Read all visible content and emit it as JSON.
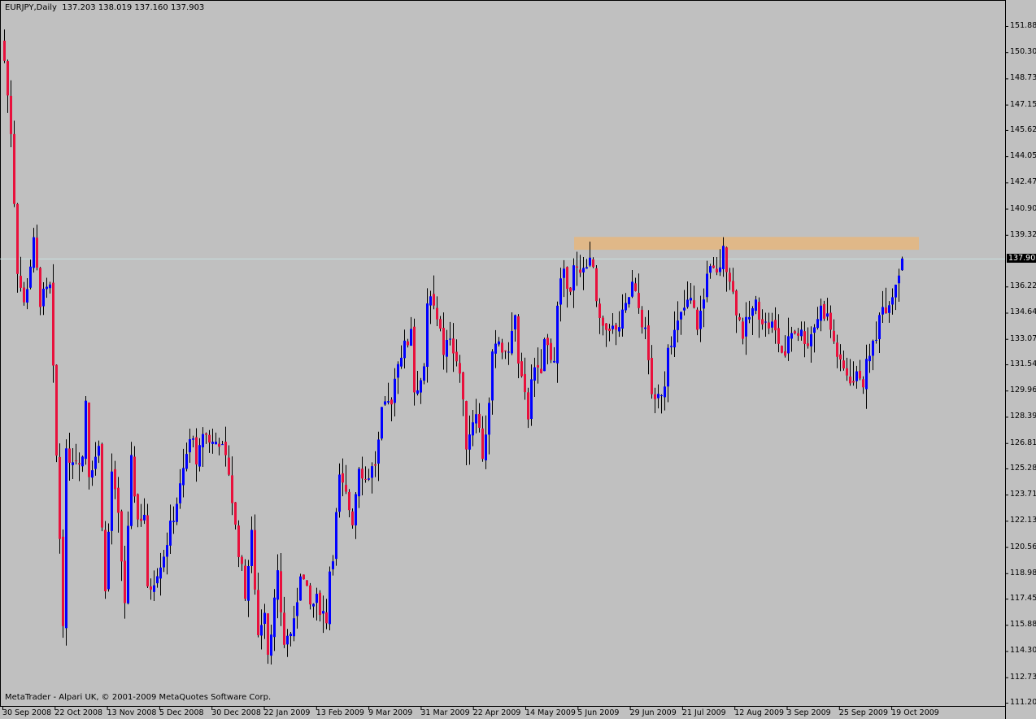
{
  "header": {
    "symbol": "EURJPY,Daily",
    "open": "137.203",
    "high": "138.019",
    "low": "137.160",
    "close": "137.903"
  },
  "footer": "MetaTrader - Alpari UK, © 2001-2009 MetaQuotes Software Corp.",
  "colors": {
    "background": "#c0c0c0",
    "bull": "#0000ff",
    "bear": "#e8103c",
    "wick": "#000000",
    "zone": "#e0b888",
    "price_line": "#c8e0e0"
  },
  "chart_data": {
    "type": "candlestick",
    "title": "EURJPY,Daily",
    "ylim": [
      111.2,
      151.88
    ],
    "y_ticks": [
      "151.880",
      "150.305",
      "148.730",
      "147.155",
      "145.625",
      "144.050",
      "142.475",
      "140.900",
      "139.325",
      "136.220",
      "134.645",
      "133.070",
      "131.540",
      "129.965",
      "128.390",
      "126.810",
      "125.285",
      "123.710",
      "122.135",
      "120.560",
      "118.985",
      "117.455",
      "115.880",
      "114.305",
      "112.730",
      "111.200"
    ],
    "current_price": "137.903",
    "x_ticks": [
      "30 Sep 2008",
      "22 Oct 2008",
      "13 Nov 2008",
      "5 Dec 2008",
      "30 Dec 2008",
      "22 Jan 2009",
      "13 Feb 2009",
      "9 Mar 2009",
      "31 Mar 2009",
      "22 Apr 2009",
      "14 May 2009",
      "5 Jun 2009",
      "29 Jun 2009",
      "21 Jul 2009",
      "12 Aug 2009",
      "3 Sep 2009",
      "25 Sep 2009",
      "19 Oct 2009"
    ],
    "resistance_zone": {
      "from_bar": 175,
      "to_bar": 281,
      "low": 138.43,
      "high": 139.2
    },
    "close_waypoints": [
      [
        0,
        149.8
      ],
      [
        2,
        145.6
      ],
      [
        4,
        137.3
      ],
      [
        6,
        135.1
      ],
      [
        9,
        138.8
      ],
      [
        11,
        135.4
      ],
      [
        14,
        136.1
      ],
      [
        15,
        131
      ],
      [
        16,
        126
      ],
      [
        18,
        116.3
      ],
      [
        19,
        126
      ],
      [
        21,
        126
      ],
      [
        24,
        126
      ],
      [
        25,
        129.5
      ],
      [
        26,
        125.1
      ],
      [
        29,
        126.5
      ],
      [
        31,
        117.8
      ],
      [
        33,
        125.1
      ],
      [
        35,
        122.2
      ],
      [
        37,
        117.3
      ],
      [
        39,
        125.6
      ],
      [
        41,
        122.2
      ],
      [
        43,
        122.6
      ],
      [
        44,
        117.8
      ],
      [
        46,
        118.7
      ],
      [
        49,
        120.2
      ],
      [
        51,
        121.7
      ],
      [
        54,
        124.1
      ],
      [
        56,
        126.1
      ],
      [
        58,
        127.5
      ],
      [
        59,
        125.1
      ],
      [
        61,
        127.5
      ],
      [
        64,
        126.8
      ],
      [
        66,
        127
      ],
      [
        69,
        125.1
      ],
      [
        71,
        121.7
      ],
      [
        74,
        117.8
      ],
      [
        76,
        121.2
      ],
      [
        78,
        115.3
      ],
      [
        80,
        117
      ],
      [
        81,
        114.3
      ],
      [
        84,
        118.7
      ],
      [
        86,
        114.8
      ],
      [
        89,
        115.8
      ],
      [
        91,
        119.2
      ],
      [
        94,
        117
      ],
      [
        96,
        117.3
      ],
      [
        99,
        116.3
      ],
      [
        100,
        119.2
      ],
      [
        101,
        120.2
      ],
      [
        103,
        124.6
      ],
      [
        105,
        123.6
      ],
      [
        107,
        122.2
      ],
      [
        109,
        125.6
      ],
      [
        111,
        124.6
      ],
      [
        114,
        125.6
      ],
      [
        115,
        126.8
      ],
      [
        116,
        128.5
      ],
      [
        119,
        129.5
      ],
      [
        121,
        131.9
      ],
      [
        124,
        132.9
      ],
      [
        125,
        133.9
      ],
      [
        126,
        130
      ],
      [
        129,
        131
      ],
      [
        130,
        134.9
      ],
      [
        131,
        135.4
      ],
      [
        134,
        133.9
      ],
      [
        135,
        131.9
      ],
      [
        137,
        133.4
      ],
      [
        140,
        131
      ],
      [
        141,
        129
      ],
      [
        142,
        126.8
      ],
      [
        145,
        129
      ],
      [
        147,
        126.1
      ],
      [
        149,
        129
      ],
      [
        150,
        131.9
      ],
      [
        152,
        132.9
      ],
      [
        154,
        131.9
      ],
      [
        156,
        133.4
      ],
      [
        157,
        134.4
      ],
      [
        158,
        131.4
      ],
      [
        160,
        129.5
      ],
      [
        161,
        128.5
      ],
      [
        162,
        131
      ],
      [
        165,
        131
      ],
      [
        166,
        132.9
      ],
      [
        169,
        131.9
      ],
      [
        170,
        134.9
      ],
      [
        171,
        136.3
      ],
      [
        172,
        136.8
      ],
      [
        174,
        136.3
      ],
      [
        175,
        137.3
      ],
      [
        177,
        136.8
      ],
      [
        179,
        137.8
      ],
      [
        181,
        137.3
      ],
      [
        182,
        134.9
      ],
      [
        184,
        133.4
      ],
      [
        186,
        133.9
      ],
      [
        188,
        133.4
      ],
      [
        189,
        133.9
      ],
      [
        191,
        134.9
      ],
      [
        193,
        136.3
      ],
      [
        195,
        134.9
      ],
      [
        197,
        133.4
      ],
      [
        199,
        130
      ],
      [
        200,
        129
      ],
      [
        203,
        130.5
      ],
      [
        204,
        132.9
      ],
      [
        206,
        133.4
      ],
      [
        209,
        134.9
      ],
      [
        211,
        135.4
      ],
      [
        213,
        133.9
      ],
      [
        215,
        135.4
      ],
      [
        216,
        137.3
      ],
      [
        219,
        136.8
      ],
      [
        221,
        138.3
      ],
      [
        223,
        136.8
      ],
      [
        224,
        135.8
      ],
      [
        225,
        134.9
      ],
      [
        227,
        133.4
      ],
      [
        229,
        134.4
      ],
      [
        231,
        135.1
      ],
      [
        234,
        133.9
      ],
      [
        236,
        133.9
      ],
      [
        238,
        132.9
      ],
      [
        240,
        131.7
      ],
      [
        241,
        133.4
      ],
      [
        243,
        133.6
      ],
      [
        245,
        133.4
      ],
      [
        247,
        132.9
      ],
      [
        249,
        133.9
      ],
      [
        251,
        134.9
      ],
      [
        253,
        134.4
      ],
      [
        255,
        132.9
      ],
      [
        257,
        131.4
      ],
      [
        259,
        131
      ],
      [
        261,
        130.5
      ],
      [
        263,
        131
      ],
      [
        264,
        130.5
      ],
      [
        266,
        132.4
      ],
      [
        268,
        132.9
      ],
      [
        269,
        134.9
      ],
      [
        271,
        135.1
      ],
      [
        273,
        135.8
      ],
      [
        274,
        136.6
      ],
      [
        275,
        137.2
      ]
    ],
    "last_bar": {
      "open": 137.203,
      "high": 138.019,
      "low": 137.16,
      "close": 137.903
    }
  }
}
